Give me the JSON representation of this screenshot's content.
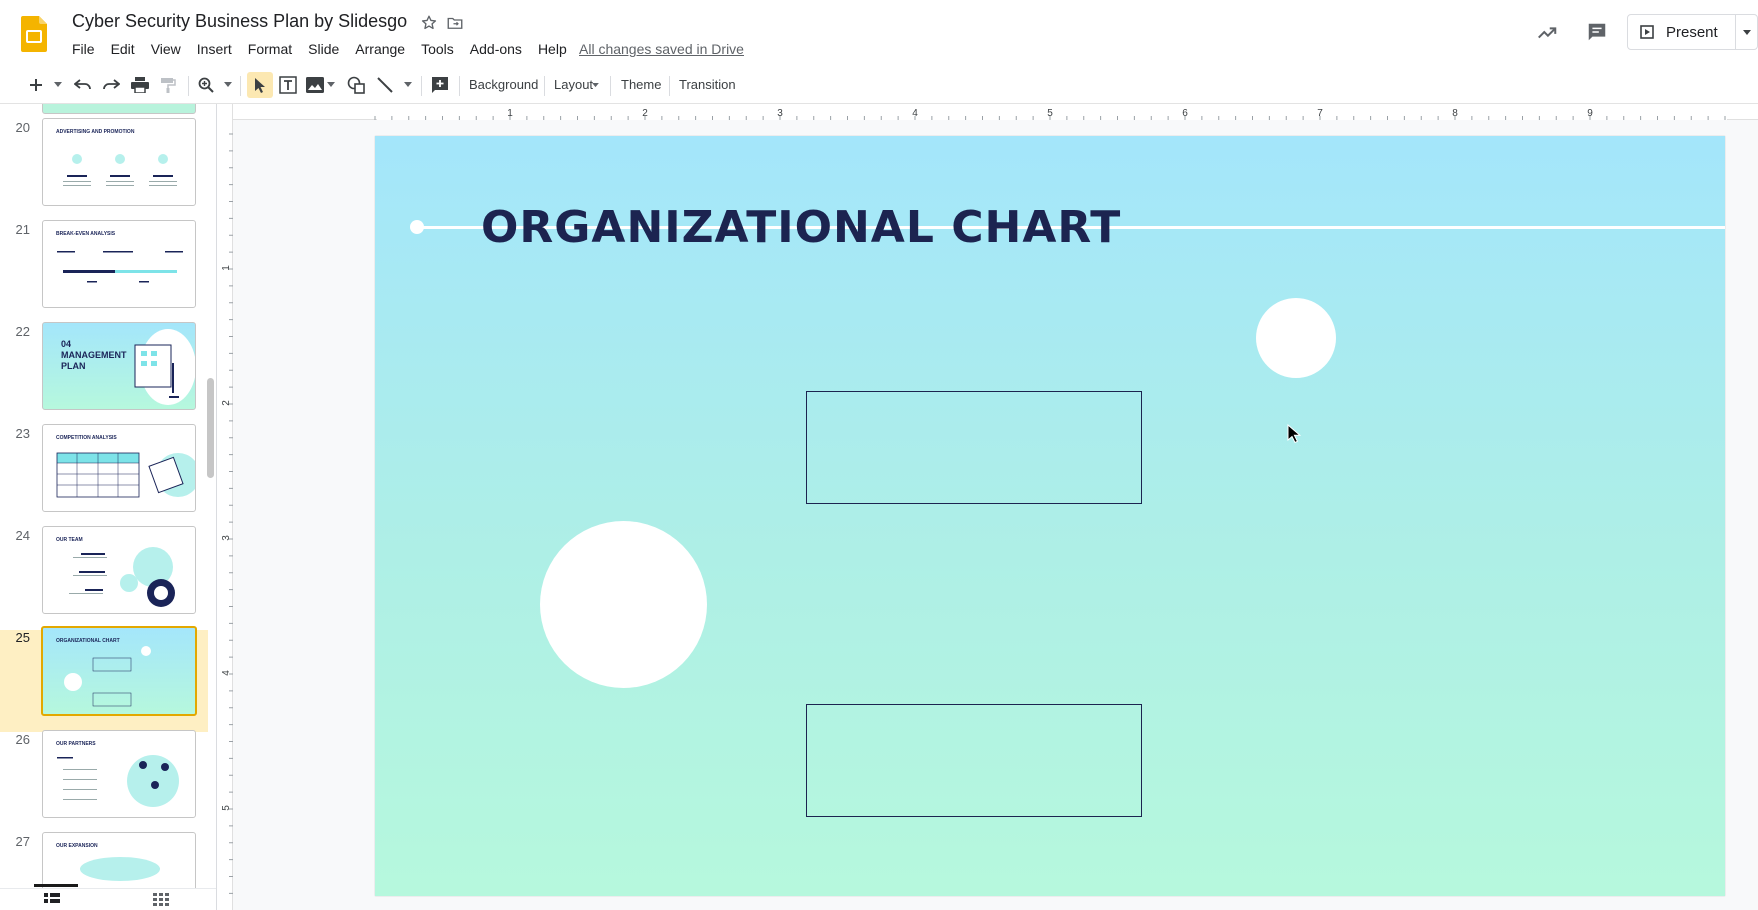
{
  "header": {
    "doc_title": "Cyber Security Business Plan by Slidesgo",
    "menu": [
      "File",
      "Edit",
      "View",
      "Insert",
      "Format",
      "Slide",
      "Arrange",
      "Tools",
      "Add-ons",
      "Help"
    ],
    "saved_status": "All changes saved in Drive",
    "present_label": "Present"
  },
  "toolbar": {
    "background_label": "Background",
    "layout_label": "Layout",
    "theme_label": "Theme",
    "transition_label": "Transition"
  },
  "ruler": {
    "h_labels": [
      "1",
      "2",
      "3",
      "4",
      "5",
      "6",
      "7",
      "8",
      "9"
    ],
    "v_labels": [
      "1",
      "2",
      "3",
      "4",
      "5"
    ]
  },
  "filmstrip": {
    "slides": [
      {
        "num": "20",
        "title": "ADVERTISING AND PROMOTION"
      },
      {
        "num": "21",
        "title": "BREAK-EVEN ANALYSIS"
      },
      {
        "num": "22",
        "title": "04 MANAGEMENT PLAN"
      },
      {
        "num": "23",
        "title": "COMPETITION ANALYSIS"
      },
      {
        "num": "24",
        "title": "OUR TEAM"
      },
      {
        "num": "25",
        "title": "ORGANIZATIONAL CHART"
      },
      {
        "num": "26",
        "title": "OUR PARTNERS"
      },
      {
        "num": "27",
        "title": "OUR EXPANSION"
      }
    ],
    "selected": "25"
  },
  "slide": {
    "title": "ORGANIZATIONAL CHART"
  },
  "colors": {
    "title_navy": "#1c2450",
    "selection_yellow": "#feefc3",
    "gradient_top": "#a4e6fb",
    "gradient_bottom": "#b6f8dd"
  }
}
